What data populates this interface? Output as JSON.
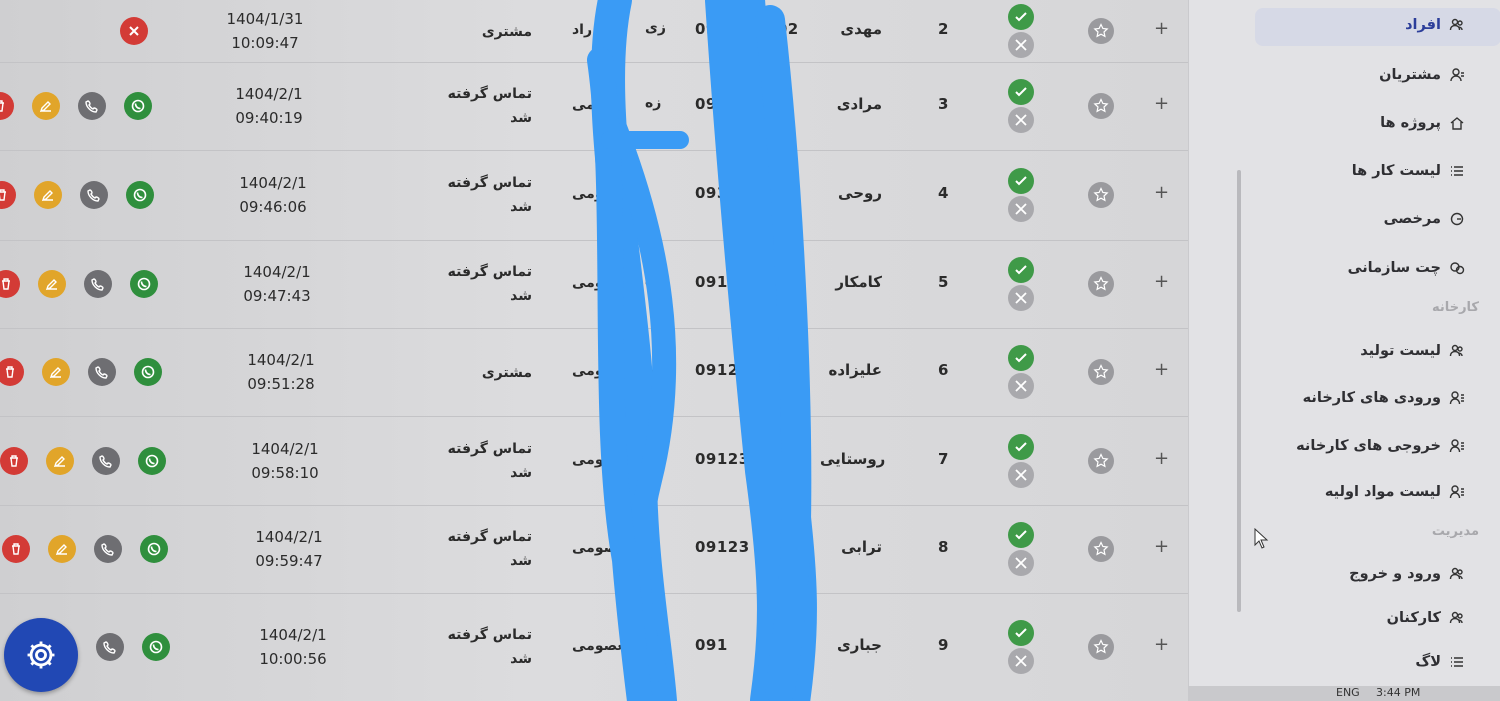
{
  "table": {
    "rows": [
      {
        "idx": "2",
        "name": "مهدی",
        "phone_prefix": "091",
        "phone_suffix": "1302",
        "source": "زی",
        "source_tail": "ن راد",
        "status": "مشتری",
        "date": "1404/1/31",
        "time": "10:09:47",
        "actions": [
          "delete-x"
        ]
      },
      {
        "idx": "3",
        "name": "مرادی",
        "phone_prefix": "093",
        "phone_suffix": "63",
        "source": "زه",
        "source_tail": "ومی",
        "status": "تماس گرفته شد",
        "date": "1404/2/1",
        "time": "09:40:19",
        "actions": [
          "whatsapp",
          "phone",
          "edit",
          "delete"
        ]
      },
      {
        "idx": "4",
        "name": "روحی",
        "phone_prefix": "0935",
        "phone_suffix": "9",
        "source": "",
        "source_tail": "معصومی",
        "status": "تماس گرفته شد",
        "date": "1404/2/1",
        "time": "09:46:06",
        "actions": [
          "whatsapp",
          "phone",
          "edit",
          "delete"
        ]
      },
      {
        "idx": "5",
        "name": "کامکار",
        "phone_prefix": "0911",
        "phone_suffix": "",
        "source": "ره",
        "source_tail": "صومی",
        "status": "تماس گرفته شد",
        "date": "1404/2/1",
        "time": "09:47:43",
        "actions": [
          "whatsapp",
          "phone",
          "edit",
          "delete"
        ]
      },
      {
        "idx": "6",
        "name": "علیزاده",
        "phone_prefix": "091251",
        "phone_suffix": "",
        "source": "هره",
        "source_tail": "صومی",
        "status": "مشتری",
        "date": "1404/2/1",
        "time": "09:51:28",
        "actions": [
          "whatsapp",
          "phone",
          "edit",
          "delete"
        ]
      },
      {
        "idx": "7",
        "name": "روستایی",
        "phone_prefix": "091233",
        "phone_suffix": "",
        "source": "",
        "source_tail": "معصومی",
        "status": "تماس گرفته شد",
        "date": "1404/2/1",
        "time": "09:58:10",
        "actions": [
          "whatsapp",
          "phone",
          "edit",
          "delete"
        ]
      },
      {
        "idx": "8",
        "name": "ترابی",
        "phone_prefix": "09123",
        "phone_suffix": "",
        "source": "",
        "source_tail": "معصومی",
        "status": "تماس گرفته شد",
        "date": "1404/2/1",
        "time": "09:59:47",
        "actions": [
          "whatsapp",
          "phone",
          "edit",
          "delete"
        ]
      },
      {
        "idx": "9",
        "name": "جباری",
        "phone_prefix": "091",
        "phone_suffix": "",
        "source": "",
        "source_tail": "معصومی",
        "status": "تماس گرفته شد",
        "date": "1404/2/1",
        "time": "10:00:56",
        "actions": [
          "whatsapp",
          "phone"
        ]
      }
    ],
    "plus_symbol": "+"
  },
  "sidebar": {
    "items": [
      {
        "label": "افراد",
        "icon": "users-icon",
        "active": true
      },
      {
        "label": "مشتریان",
        "icon": "customers-icon"
      },
      {
        "label": "پروژه ها",
        "icon": "home-icon"
      },
      {
        "label": "لیست کار ها",
        "icon": "list-icon"
      },
      {
        "label": "مرخصی",
        "icon": "leave-icon"
      },
      {
        "label": "چت سازمانی",
        "icon": "chat-icon"
      }
    ],
    "section_factory": "کارخانه",
    "factory_items": [
      {
        "label": "لیست تولید",
        "icon": "users-icon"
      },
      {
        "label": "ورودی های کارخانه",
        "icon": "user-list-icon"
      },
      {
        "label": "خروجی های کارخانه",
        "icon": "user-list-icon"
      },
      {
        "label": "لیست مواد اولیه",
        "icon": "user-list-icon"
      }
    ],
    "section_management": "مدیریت",
    "management_items": [
      {
        "label": "ورود و خروج",
        "icon": "users-icon"
      },
      {
        "label": "کارکنان",
        "icon": "users-icon"
      },
      {
        "label": "لاگ",
        "icon": "list-icon"
      }
    ]
  },
  "taskbar": {
    "lang": "ENG",
    "time": "3:44 PM"
  },
  "colors": {
    "whatsapp": "#2f8f3d",
    "phone": "#6e6e72",
    "edit": "#e1a52a",
    "delete": "#d33b36",
    "ok": "#3f9a48",
    "gear": "#2148b4",
    "scribble": "#3a9bf5"
  }
}
